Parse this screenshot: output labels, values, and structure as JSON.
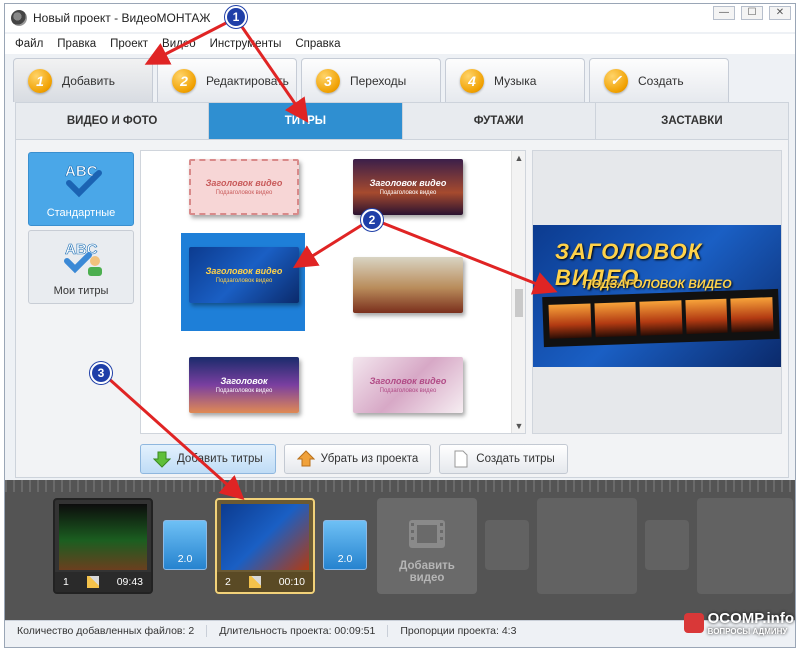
{
  "window": {
    "title": "Новый проект - ВидеоМОНТАЖ"
  },
  "menu": [
    "Файл",
    "Правка",
    "Проект",
    "Видео",
    "Инструменты",
    "Справка"
  ],
  "main_tabs": [
    {
      "num": "1",
      "label": "Добавить"
    },
    {
      "num": "2",
      "label": "Редактировать"
    },
    {
      "num": "3",
      "label": "Переходы"
    },
    {
      "num": "4",
      "label": "Музыка"
    },
    {
      "num": "",
      "label": "Создать"
    }
  ],
  "sub_tabs": [
    "ВИДЕО И ФОТО",
    "ТИТРЫ",
    "ФУТАЖИ",
    "ЗАСТАВКИ"
  ],
  "categories": [
    {
      "label": "Стандартные",
      "icon": "abc-check-icon"
    },
    {
      "label": "Мои титры",
      "icon": "abc-user-icon"
    }
  ],
  "thumbnails": [
    {
      "title": "Заголовок видео",
      "sub": "Подзаголовок видео"
    },
    {
      "title": "Заголовок видео",
      "sub": "Подзаголовок видео"
    },
    {
      "title": "Заголовок видео",
      "sub": "Подзаголовок видео"
    },
    {
      "title": "",
      "sub": ""
    },
    {
      "title": "Заголовок",
      "sub": "Подзаголовок видео"
    },
    {
      "title": "Заголовок видео",
      "sub": "Подзаголовок видео"
    }
  ],
  "preview": {
    "title": "ЗАГОЛОВОК ВИДЕО",
    "subtitle": "ПОДЗАГОЛОВОК ВИДЕО"
  },
  "actions": {
    "add": "Добавить титры",
    "remove": "Убрать из проекта",
    "create": "Создать титры"
  },
  "timeline": {
    "clips": [
      {
        "index": "1",
        "duration": "09:43"
      },
      {
        "index": "2",
        "duration": "00:10"
      }
    ],
    "transitions": [
      "2.0",
      "2.0"
    ],
    "add_video": "Добавить видео"
  },
  "status": {
    "files": "Количество добавленных файлов: 2",
    "duration": "Длительность проекта:   00:09:51",
    "ratio": "Пропорции проекта:   4:3"
  },
  "callouts": [
    "1",
    "2",
    "3"
  ],
  "watermark": {
    "line1": "OCOMP.info",
    "line2": "ВОПРОСЫ АДМИНУ"
  },
  "colors": {
    "accent": "#2f8fd1",
    "arrow": "#e02424",
    "callout": "#1f3fa8"
  }
}
